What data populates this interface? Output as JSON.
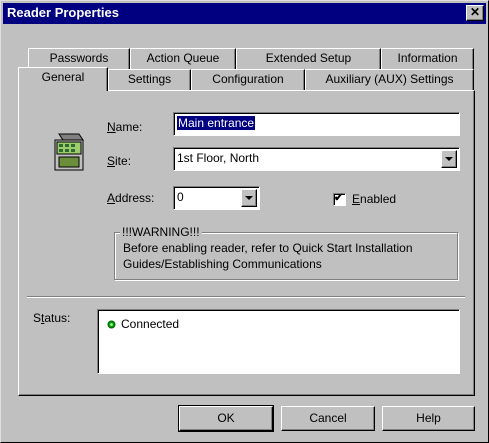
{
  "window": {
    "title": "Reader Properties",
    "close_glyph": "✕"
  },
  "tabs": {
    "row1": [
      "Passwords",
      "Action Queue",
      "Extended Setup",
      "Information"
    ],
    "row2": [
      "General",
      "Settings",
      "Configuration",
      "Auxiliary (AUX) Settings"
    ],
    "active": "General"
  },
  "general": {
    "icon": "card-reader-icon",
    "name_label_u": "N",
    "name_label_rest": "ame:",
    "name_value": "Main entrance",
    "site_label_u": "S",
    "site_label_rest": "ite:",
    "site_value": "1st Floor, North",
    "address_label_u": "A",
    "address_label_rest": "ddress:",
    "address_value": "0",
    "enabled_label_u": "E",
    "enabled_label_rest": "nabled",
    "enabled_checked": true,
    "check_glyph": "✔",
    "warning_title": "!!!WARNING!!!",
    "warning_line1": "Before enabling reader, refer to Quick Start Installation",
    "warning_line2": "Guides/Establishing Communications",
    "status_label_u": "t",
    "status_label_pre": "S",
    "status_label_rest": "atus:",
    "status_text": "Connected",
    "status_color": "#00a000"
  },
  "buttons": {
    "ok": "OK",
    "cancel": "Cancel",
    "help": "Help"
  },
  "colors": {
    "titlebar": "#000080",
    "face": "#c0c0c0",
    "selection": "#000080"
  }
}
